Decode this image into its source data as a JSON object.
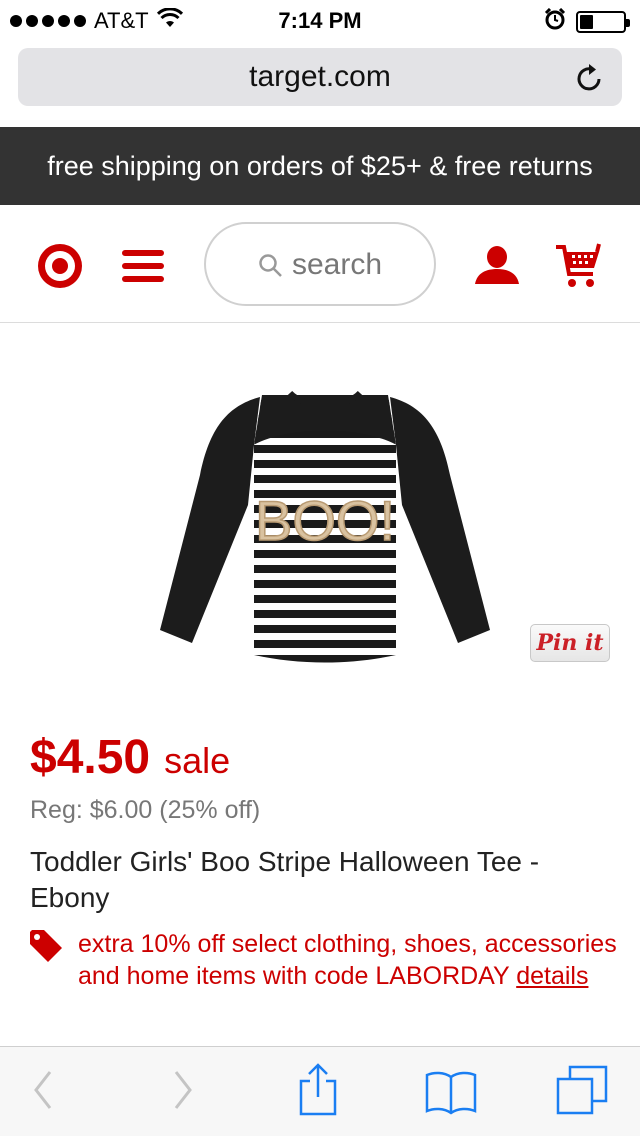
{
  "status_bar": {
    "carrier": "AT&T",
    "time": "7:14 PM",
    "battery_level": 0.3
  },
  "browser": {
    "url": "target.com"
  },
  "promo_banner": {
    "text": "free shipping on orders of $25+ & free returns"
  },
  "header": {
    "search_placeholder": "search"
  },
  "product": {
    "price": "$4.50",
    "sale_label": "sale",
    "regular_price": "Reg: $6.00 (25% off)",
    "title": "Toddler Girls' Boo Stripe Halloween Tee - Ebony",
    "image_text": "BOO!",
    "pin_label": "Pin it",
    "offer_text": "extra 10% off select clothing, shoes, accessories and home items with code LABORDAY",
    "offer_link": "details"
  },
  "colors": {
    "brand_red": "#cc0000",
    "banner_bg": "#333333",
    "ios_blue": "#1a7ef2"
  },
  "icons": [
    "wifi-icon",
    "alarm-icon",
    "battery-icon",
    "reload-icon",
    "target-logo",
    "menu-icon",
    "search-icon",
    "account-icon",
    "cart-icon",
    "price-tag-icon",
    "back-icon",
    "forward-icon",
    "share-icon",
    "bookmarks-icon",
    "tabs-icon"
  ]
}
